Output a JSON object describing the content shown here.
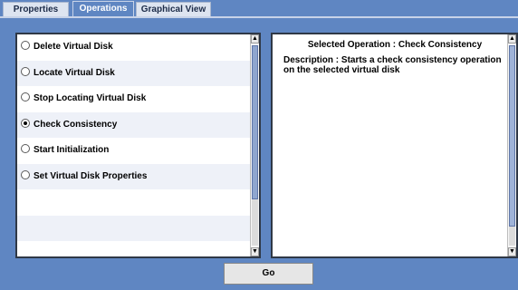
{
  "tabs": [
    {
      "label": "Properties",
      "active": false
    },
    {
      "label": "Operations",
      "active": true
    },
    {
      "label": "Graphical View",
      "active": false
    }
  ],
  "operations": [
    {
      "label": "Delete Virtual Disk",
      "selected": false
    },
    {
      "label": "Locate Virtual Disk",
      "selected": false
    },
    {
      "label": "Stop Locating Virtual Disk",
      "selected": false
    },
    {
      "label": "Check Consistency",
      "selected": true
    },
    {
      "label": "Start Initialization",
      "selected": false
    },
    {
      "label": "Set Virtual Disk Properties",
      "selected": false
    }
  ],
  "details": {
    "title": "Selected Operation : Check Consistency",
    "description": "Description : Starts a check consistency operation on the selected virtual disk"
  },
  "go_label": "Go",
  "colors": {
    "background": "#5f86c2",
    "scroll_thumb": "#8fa6cf"
  }
}
